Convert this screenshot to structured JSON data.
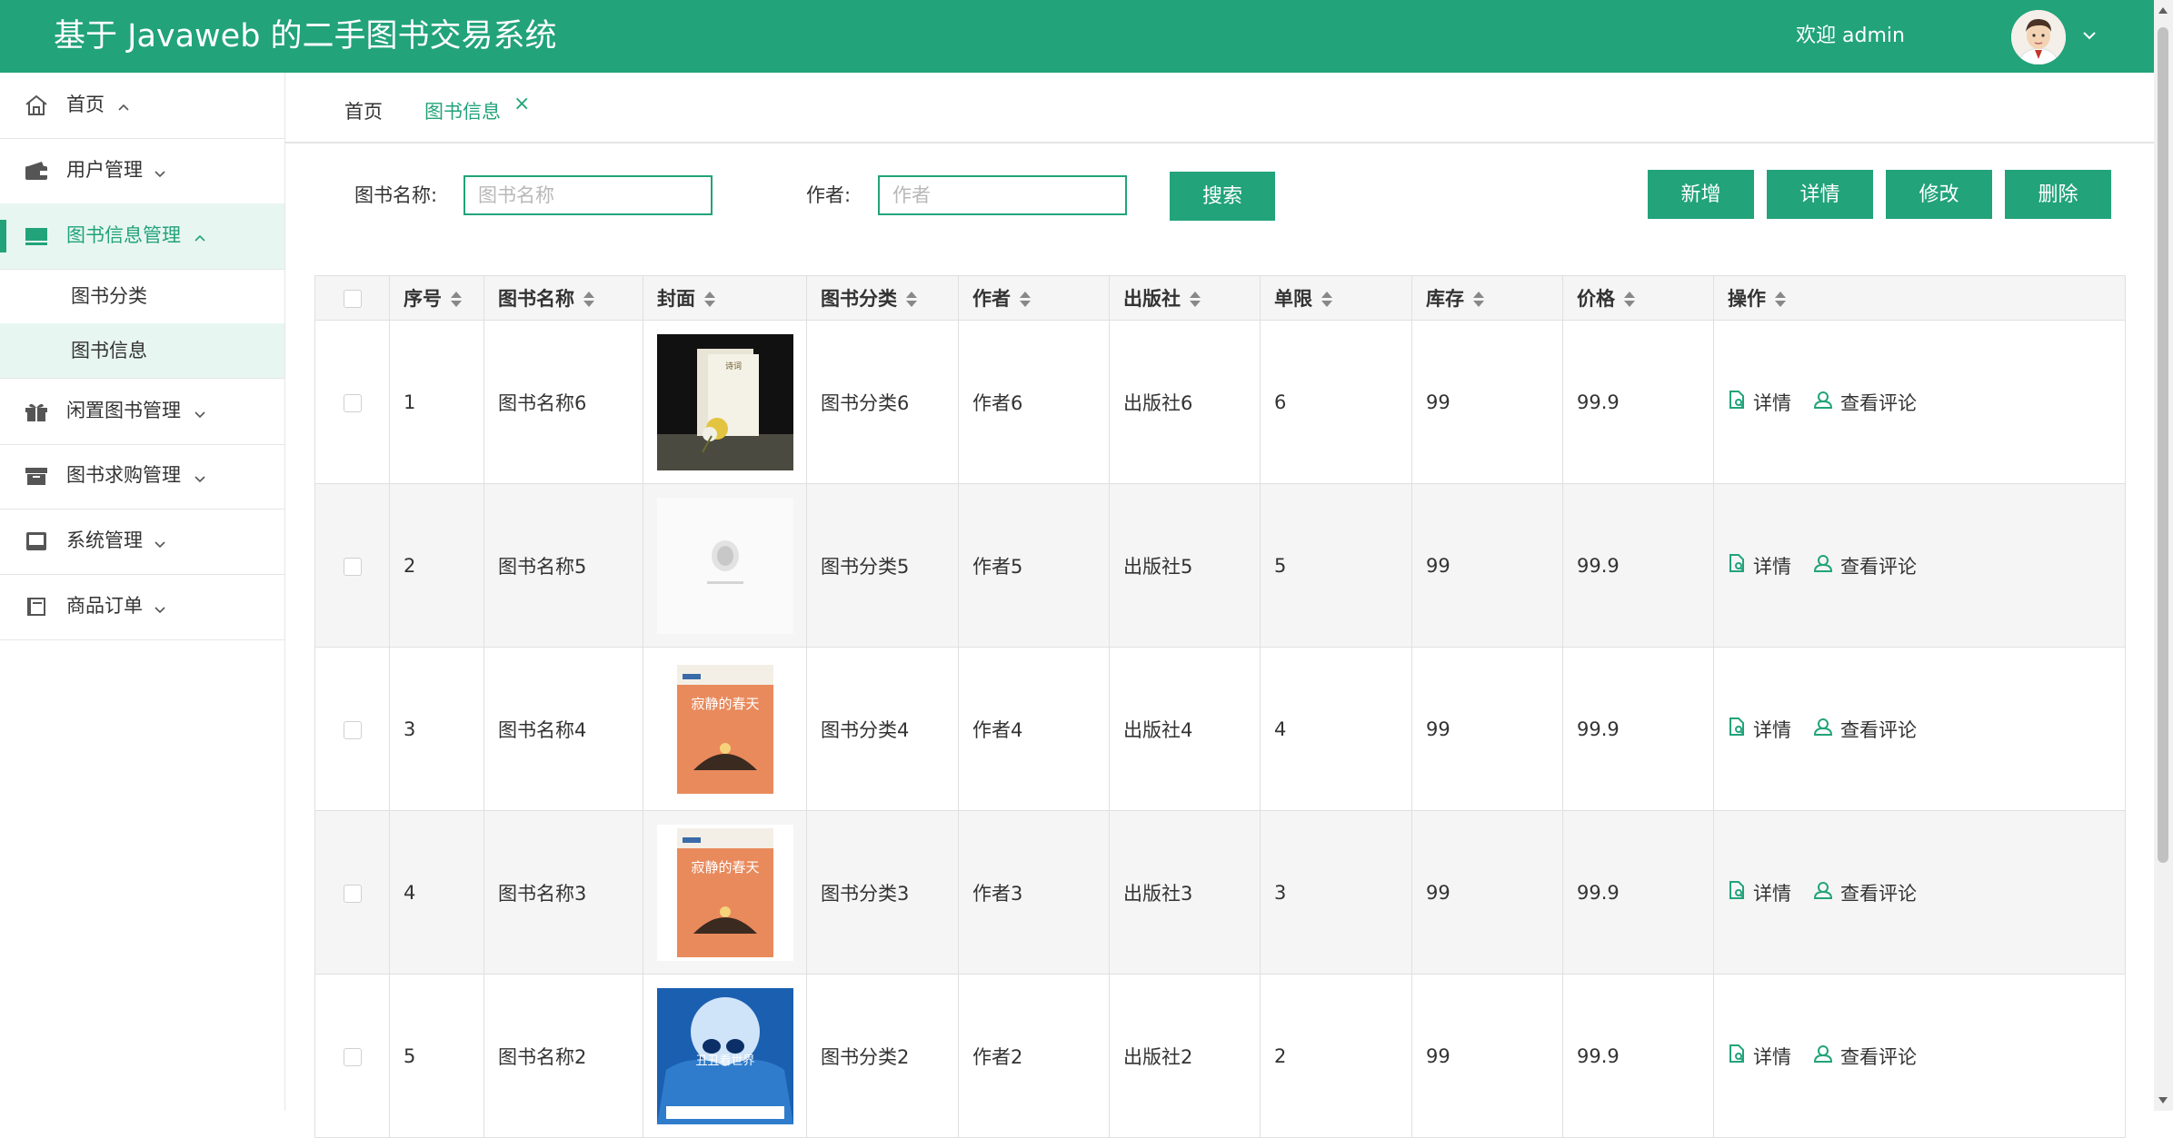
{
  "app": {
    "title": "基于 Javaweb 的二手图书交易系统",
    "welcome": "欢迎 admin"
  },
  "sidebar": {
    "items": [
      {
        "label": "首页",
        "icon": "home-icon"
      },
      {
        "label": "用户管理",
        "icon": "wallet-icon"
      },
      {
        "label": "图书信息管理",
        "icon": "monitor-icon",
        "active": true
      },
      {
        "label": "闲置图书管理",
        "icon": "gift-icon"
      },
      {
        "label": "图书求购管理",
        "icon": "archive-icon"
      },
      {
        "label": "系统管理",
        "icon": "tablet-icon"
      },
      {
        "label": "商品订单",
        "icon": "book-icon"
      }
    ],
    "subitems": [
      {
        "label": "图书分类"
      },
      {
        "label": "图书信息",
        "active": true
      }
    ]
  },
  "tabs": [
    {
      "label": "首页"
    },
    {
      "label": "图书信息",
      "active": true,
      "close": "×"
    }
  ],
  "search": {
    "name_label": "图书名称:",
    "name_placeholder": "图书名称",
    "name_value": "",
    "author_label": "作者:",
    "author_placeholder": "作者",
    "author_value": "",
    "search_button": "搜索"
  },
  "toolbar": {
    "add": "新增",
    "detail": "详情",
    "edit": "修改",
    "delete": "删除"
  },
  "table": {
    "headers": [
      "序号",
      "图书名称",
      "封面",
      "图书分类",
      "作者",
      "出版社",
      "单限",
      "库存",
      "价格",
      "操作"
    ],
    "rows": [
      {
        "no": "1",
        "name": "图书名称6",
        "category": "图书分类6",
        "author": "作者6",
        "publisher": "出版社6",
        "limit": "6",
        "stock": "99",
        "price": "99.9",
        "cover": "dark-poetry-cover"
      },
      {
        "no": "2",
        "name": "图书名称5",
        "category": "图书分类5",
        "author": "作者5",
        "publisher": "出版社5",
        "limit": "5",
        "stock": "99",
        "price": "99.9",
        "cover": "white-cover"
      },
      {
        "no": "3",
        "name": "图书名称4",
        "category": "图书分类4",
        "author": "作者4",
        "publisher": "出版社4",
        "limit": "4",
        "stock": "99",
        "price": "99.9",
        "cover": "orange-spring-cover",
        "cover_title": "寂静的春天"
      },
      {
        "no": "4",
        "name": "图书名称3",
        "category": "图书分类3",
        "author": "作者3",
        "publisher": "出版社3",
        "limit": "3",
        "stock": "99",
        "price": "99.9",
        "cover": "orange-spring-cover",
        "cover_title": "寂静的春天"
      },
      {
        "no": "5",
        "name": "图书名称2",
        "category": "图书分类2",
        "author": "作者2",
        "publisher": "出版社2",
        "limit": "2",
        "stock": "99",
        "price": "99.9",
        "cover": "blue-moon-cover",
        "cover_title": "丑丑看世界"
      }
    ],
    "actions": {
      "detail": "详情",
      "comments": "查看评论"
    }
  },
  "colors": {
    "primary": "#22a37a",
    "active_bg": "#e8f6f1"
  }
}
